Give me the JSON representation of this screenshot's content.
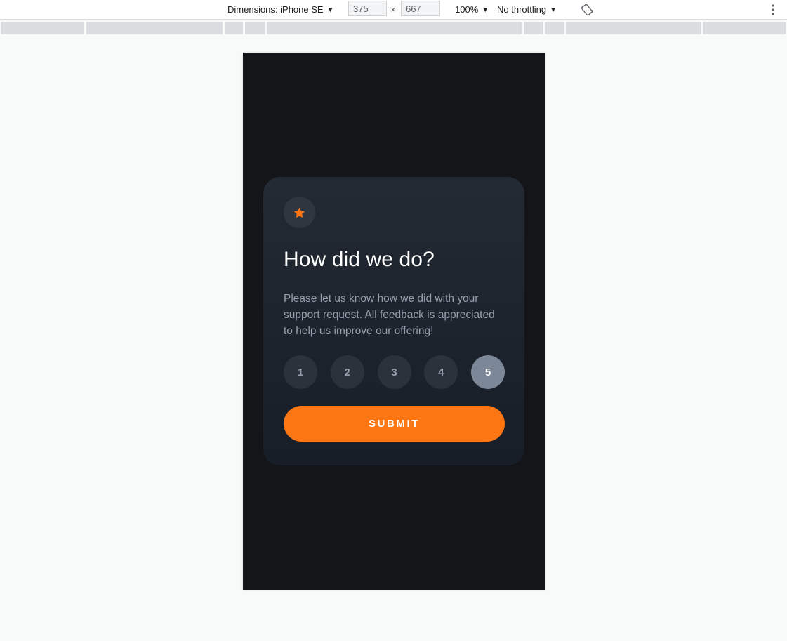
{
  "devtools": {
    "dimensions_label": "Dimensions: iPhone SE",
    "width_value": "375",
    "height_value": "667",
    "times": "×",
    "zoom": "100%",
    "throttling": "No throttling"
  },
  "card": {
    "title": "How did we do?",
    "description": "Please let us know how we did with your support request. All feedback is appreciated to help us improve our offering!",
    "ratings": [
      "1",
      "2",
      "3",
      "4",
      "5"
    ],
    "selected_rating": "5",
    "submit_label": "SUBMIT"
  },
  "colors": {
    "accent": "#fc7614",
    "background": "#141519",
    "card": "#232a34",
    "selected": "#7c8798"
  },
  "icons": {
    "badge": "star-icon",
    "rotate": "rotate-icon",
    "more": "more-vertical-icon"
  }
}
